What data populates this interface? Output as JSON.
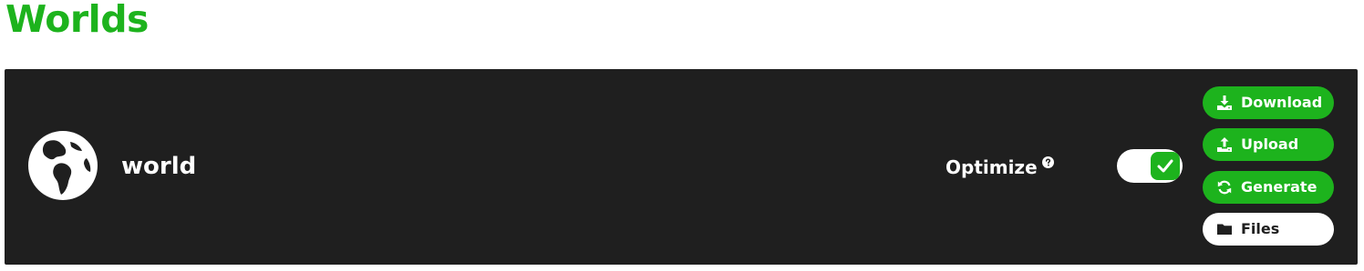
{
  "page": {
    "title": "Worlds"
  },
  "world": {
    "name": "world",
    "icon": "globe-icon",
    "optimize": {
      "label": "Optimize",
      "help_icon": "question-circle-icon",
      "enabled": true
    },
    "actions": [
      {
        "label": "Download",
        "icon": "download-icon",
        "style": "green"
      },
      {
        "label": "Upload",
        "icon": "upload-icon",
        "style": "green"
      },
      {
        "label": "Generate",
        "icon": "sync-icon",
        "style": "green"
      },
      {
        "label": "Files",
        "icon": "folder-icon",
        "style": "white"
      }
    ]
  },
  "colors": {
    "accent": "#1db31d",
    "card_background": "#1f1f1f",
    "text_light": "#ffffff",
    "text_dark": "#1f1f1f"
  }
}
